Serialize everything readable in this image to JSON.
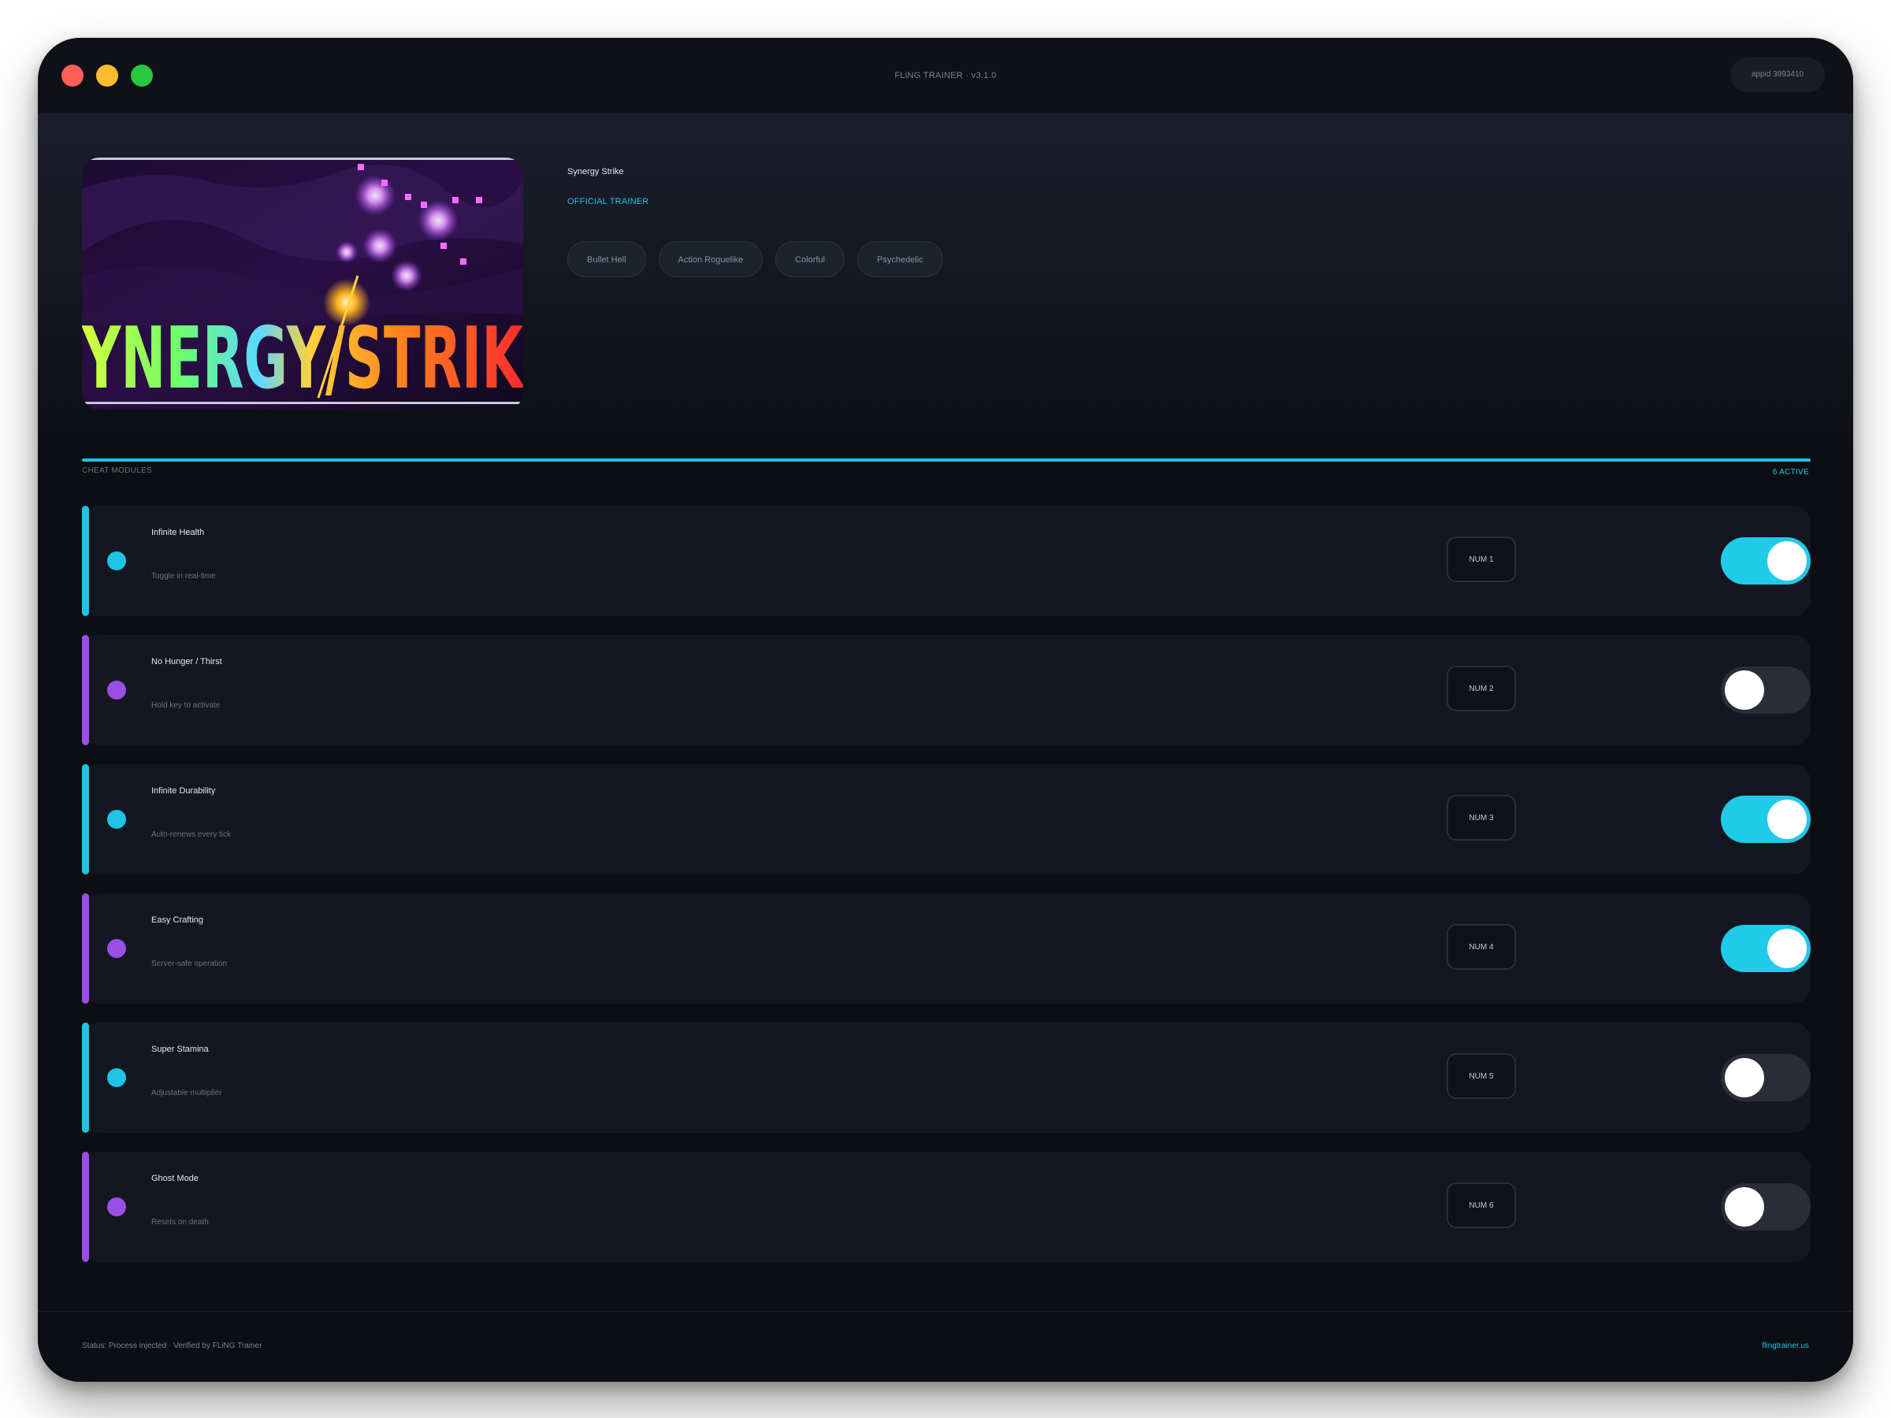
{
  "window": {
    "title": "FLiNG TRAINER · v3.1.0",
    "appid": "appid 3893410"
  },
  "game": {
    "title": "Synergy Strike",
    "badge": "OFFICIAL TRAINER",
    "cover_wordmark": "YNERGY/STRIK",
    "tags": [
      "Bullet Hell",
      "Action Roguelike",
      "Colorful",
      "Psychedelic"
    ]
  },
  "section": {
    "label": "CHEAT MODULES",
    "active_count": "6 ACTIVE"
  },
  "colors": {
    "cyan": "#1ec4e4",
    "purple": "#9b4ee6"
  },
  "cheats": [
    {
      "name": "Infinite Health",
      "desc": "Toggle in real-time",
      "key": "NUM 1",
      "on": true,
      "accent": "cyan"
    },
    {
      "name": "No Hunger / Thirst",
      "desc": "Hold key to activate",
      "key": "NUM 2",
      "on": false,
      "accent": "purple"
    },
    {
      "name": "Infinite Durability",
      "desc": "Auto-renews every tick",
      "key": "NUM 3",
      "on": true,
      "accent": "cyan"
    },
    {
      "name": "Easy Crafting",
      "desc": "Server-safe operation",
      "key": "NUM 4",
      "on": true,
      "accent": "purple"
    },
    {
      "name": "Super Stamina",
      "desc": "Adjustable multiplier",
      "key": "NUM 5",
      "on": false,
      "accent": "cyan"
    },
    {
      "name": "Ghost Mode",
      "desc": "Resets on death",
      "key": "NUM 6",
      "on": false,
      "accent": "purple"
    }
  ],
  "footer": {
    "status": "Status: Process injected · Verified by FLiNG Trainer",
    "site": "flingtrainer.us"
  }
}
